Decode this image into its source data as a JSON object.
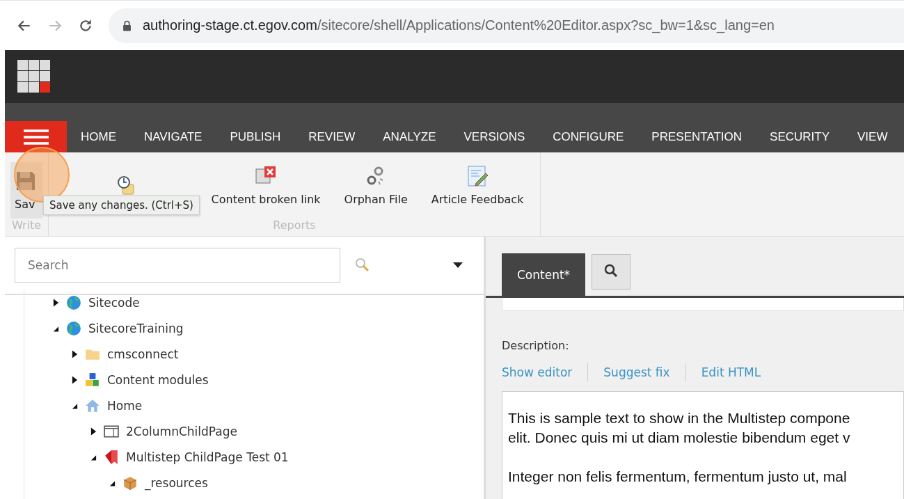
{
  "browser": {
    "url_host": "authoring-stage.ct.egov.com",
    "url_path": "/sitecore/shell/Applications/Content%20Editor.aspx?sc_bw=1&sc_lang=en"
  },
  "nav": {
    "tabs": [
      {
        "label": "HOME",
        "selected": false
      },
      {
        "label": "NAVIGATE",
        "selected": false
      },
      {
        "label": "PUBLISH",
        "selected": false
      },
      {
        "label": "REVIEW",
        "selected": false
      },
      {
        "label": "ANALYZE",
        "selected": false
      },
      {
        "label": "VERSIONS",
        "selected": false
      },
      {
        "label": "CONFIGURE",
        "selected": false
      },
      {
        "label": "PRESENTATION",
        "selected": false
      },
      {
        "label": "SECURITY",
        "selected": false
      },
      {
        "label": "VIEW",
        "selected": false
      }
    ]
  },
  "ribbon": {
    "groups": [
      {
        "title": "Write",
        "buttons": [
          {
            "kind": "save",
            "label": "Sav"
          }
        ]
      },
      {
        "title": "Reports",
        "buttons": [
          {
            "kind": "clock"
          },
          {
            "kind": "broken",
            "label": "Content broken link"
          },
          {
            "kind": "orphan",
            "label": "Orphan File"
          },
          {
            "kind": "feedback",
            "label": "Article Feedback"
          }
        ]
      }
    ],
    "tooltip": "Save any changes. (Ctrl+S)"
  },
  "search": {
    "placeholder": "Search"
  },
  "tree": [
    {
      "label": "Sitecode",
      "kind": "globe",
      "expanded": false
    },
    {
      "label": "SitecoreTraining",
      "kind": "globe",
      "expanded": true,
      "children": [
        {
          "label": "cmsconnect",
          "kind": "folder",
          "expanded": false
        },
        {
          "label": "Content modules",
          "kind": "cubes",
          "expanded": false
        },
        {
          "label": "Home",
          "kind": "home",
          "expanded": true,
          "children": [
            {
              "label": "2ColumnChildPage",
              "kind": "page",
              "expanded": false
            },
            {
              "label": "Multistep ChildPage Test 01",
              "kind": "bookmark",
              "expanded": true,
              "children": [
                {
                  "label": "_resources",
                  "kind": "box",
                  "expanded": true
                }
              ]
            }
          ]
        }
      ]
    }
  ],
  "editor": {
    "tabs": [
      {
        "kind": "text",
        "label": "Content*",
        "selected": true
      },
      {
        "kind": "search",
        "selected": false
      }
    ],
    "field_label": "Description:",
    "links": [
      "Show editor",
      "Suggest fix",
      "Edit HTML"
    ],
    "paragraphs": [
      [
        "This is sample text to show in the Multistep compone",
        "elit. Donec quis mi ut diam molestie bibendum eget v"
      ],
      [
        "Integer non felis fermentum, fermentum justo ut, mal"
      ]
    ]
  }
}
